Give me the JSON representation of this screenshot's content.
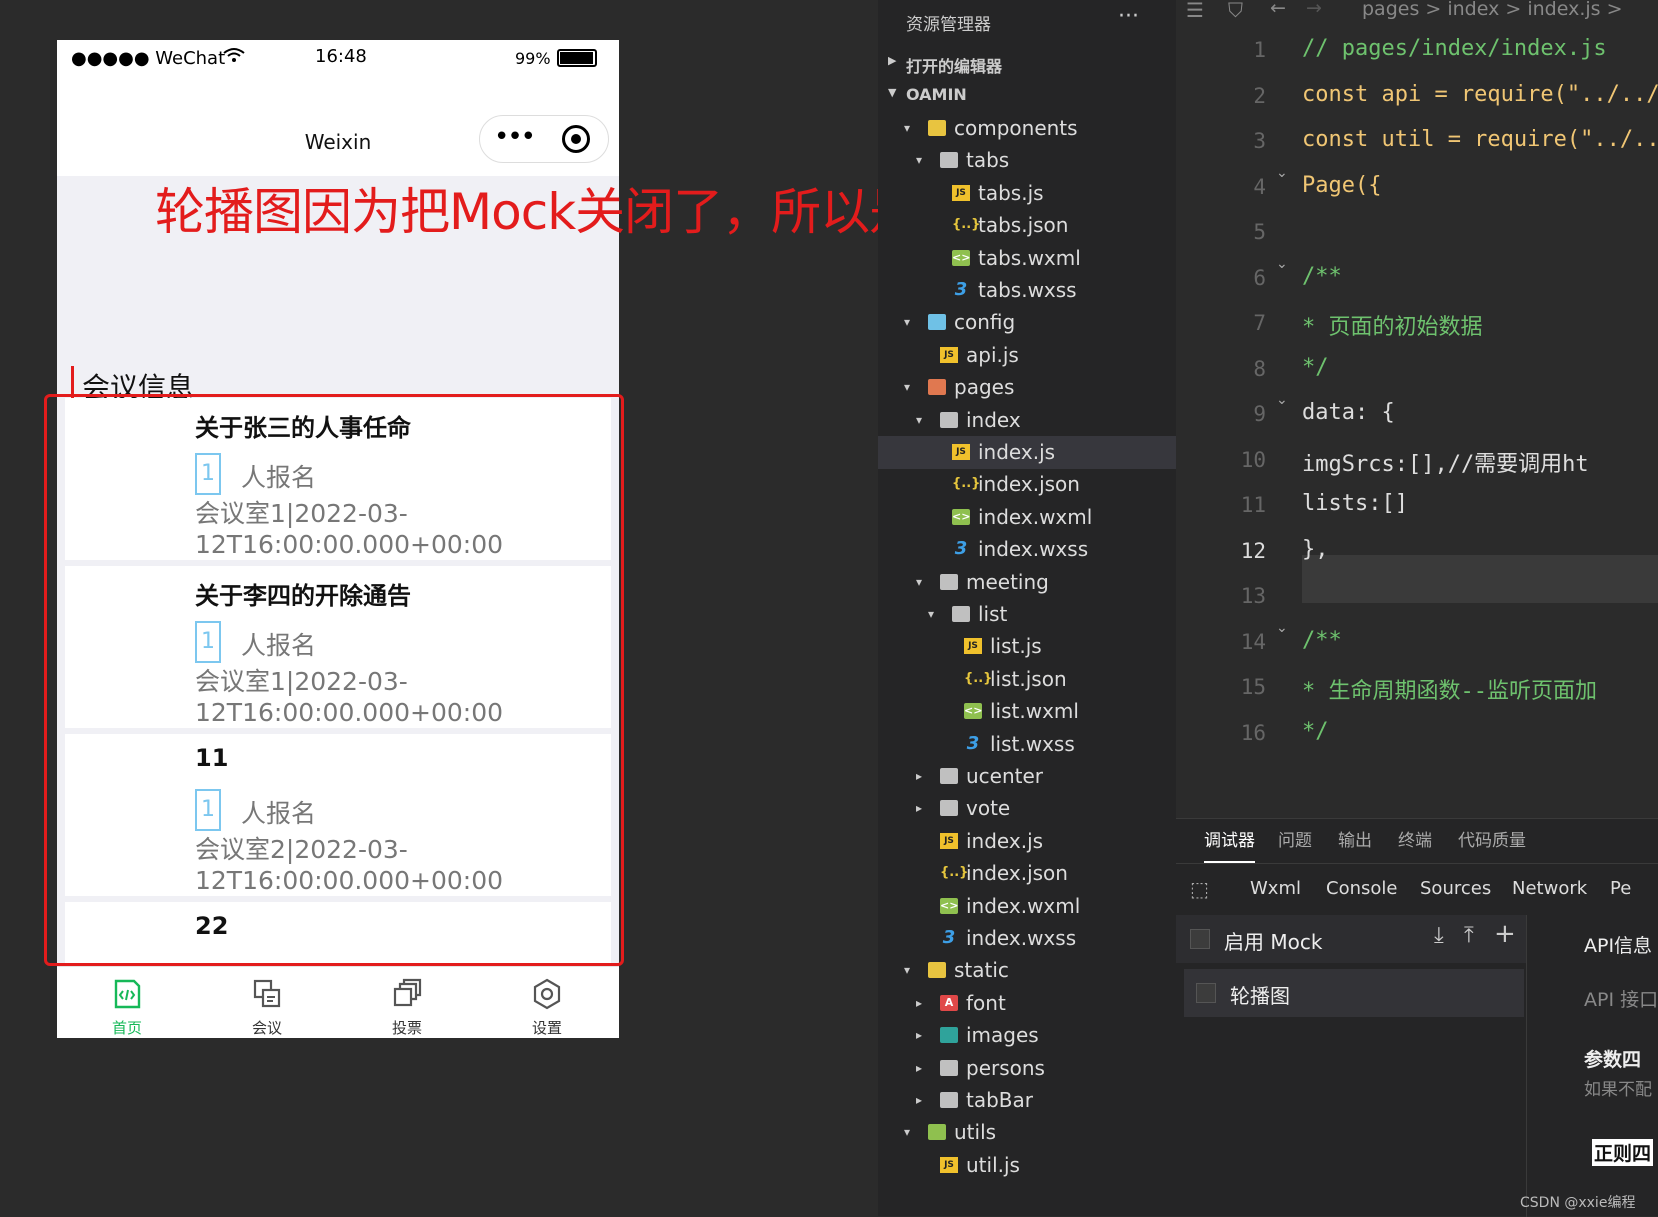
{
  "phone": {
    "status": {
      "carrier": "●●●●● WeChat",
      "time": "16:48",
      "battery": "99%"
    },
    "nav": {
      "title": "Weixin",
      "more": "•••",
      "record": "◉"
    },
    "section_title": "会议信息",
    "annotation": "轮播图因为把Mock关闭了，所以是没有数据的",
    "meetings": [
      {
        "title": "关于张三的人事任命",
        "count": "1",
        "signup": "人报名",
        "location": "会议室1|2022-03-12T16:00:00.000+00:00"
      },
      {
        "title": "关于李四的开除通告",
        "count": "1",
        "signup": "人报名",
        "location": "会议室1|2022-03-12T16:00:00.000+00:00"
      },
      {
        "title": "11",
        "count": "1",
        "signup": "人报名",
        "location": "会议室2|2022-03-12T16:00:00.000+00:00"
      },
      {
        "title": "22",
        "count": "",
        "signup": "",
        "location": ""
      }
    ],
    "tabs": [
      {
        "label": "首页",
        "icon": "home-code-icon",
        "active": true
      },
      {
        "label": "会议",
        "icon": "meeting-icon",
        "active": false
      },
      {
        "label": "投票",
        "icon": "vote-icon",
        "active": false
      },
      {
        "label": "设置",
        "icon": "settings-icon",
        "active": false
      }
    ]
  },
  "explorer": {
    "title": "资源管理器",
    "more": "···",
    "open_editors": "打开的编辑器",
    "project": "OAMIN",
    "tree": [
      {
        "name": "components",
        "icon": "fcomp",
        "arrow": "▾",
        "indent": 0
      },
      {
        "name": "tabs",
        "icon": "folder",
        "arrow": "▾",
        "indent": 1
      },
      {
        "name": "tabs.js",
        "icon": "js",
        "arrow": "",
        "indent": 2
      },
      {
        "name": "tabs.json",
        "icon": "json",
        "arrow": "",
        "indent": 2
      },
      {
        "name": "tabs.wxml",
        "icon": "wxml",
        "arrow": "",
        "indent": 2
      },
      {
        "name": "tabs.wxss",
        "icon": "wxss",
        "arrow": "",
        "indent": 2
      },
      {
        "name": "config",
        "icon": "fcfg",
        "arrow": "▾",
        "indent": 0
      },
      {
        "name": "api.js",
        "icon": "js",
        "arrow": "",
        "indent": 1
      },
      {
        "name": "pages",
        "icon": "fpage",
        "arrow": "▾",
        "indent": 0
      },
      {
        "name": "index",
        "icon": "folder",
        "arrow": "▾",
        "indent": 1
      },
      {
        "name": "index.js",
        "icon": "js",
        "arrow": "",
        "indent": 2,
        "selected": true
      },
      {
        "name": "index.json",
        "icon": "json",
        "arrow": "",
        "indent": 2
      },
      {
        "name": "index.wxml",
        "icon": "wxml",
        "arrow": "",
        "indent": 2
      },
      {
        "name": "index.wxss",
        "icon": "wxss",
        "arrow": "",
        "indent": 2
      },
      {
        "name": "meeting",
        "icon": "folder",
        "arrow": "▾",
        "indent": 1
      },
      {
        "name": "list",
        "icon": "folder",
        "arrow": "▾",
        "indent": 2
      },
      {
        "name": "list.js",
        "icon": "js",
        "arrow": "",
        "indent": 3
      },
      {
        "name": "list.json",
        "icon": "json",
        "arrow": "",
        "indent": 3
      },
      {
        "name": "list.wxml",
        "icon": "wxml",
        "arrow": "",
        "indent": 3
      },
      {
        "name": "list.wxss",
        "icon": "wxss",
        "arrow": "",
        "indent": 3
      },
      {
        "name": "ucenter",
        "icon": "folder",
        "arrow": "▸",
        "indent": 1
      },
      {
        "name": "vote",
        "icon": "folder",
        "arrow": "▸",
        "indent": 1
      },
      {
        "name": "index.js",
        "icon": "js",
        "arrow": "",
        "indent": 1
      },
      {
        "name": "index.json",
        "icon": "json",
        "arrow": "",
        "indent": 1
      },
      {
        "name": "index.wxml",
        "icon": "wxml",
        "arrow": "",
        "indent": 1
      },
      {
        "name": "index.wxss",
        "icon": "wxss",
        "arrow": "",
        "indent": 1
      },
      {
        "name": "static",
        "icon": "fstat",
        "arrow": "▾",
        "indent": 0
      },
      {
        "name": "font",
        "icon": "ffont",
        "arrow": "▸",
        "indent": 1
      },
      {
        "name": "images",
        "icon": "fimg",
        "arrow": "▸",
        "indent": 1
      },
      {
        "name": "persons",
        "icon": "folder",
        "arrow": "▸",
        "indent": 1
      },
      {
        "name": "tabBar",
        "icon": "folder",
        "arrow": "▸",
        "indent": 1
      },
      {
        "name": "utils",
        "icon": "futil",
        "arrow": "▾",
        "indent": 0
      },
      {
        "name": "util.js",
        "icon": "js",
        "arrow": "",
        "indent": 1
      }
    ]
  },
  "editor": {
    "breadcrumb": "pages > index > index.js >",
    "lines": [
      {
        "n": "1",
        "code": "// pages/index/index.js",
        "cls": "c"
      },
      {
        "n": "2",
        "code": "const api = require(\"../../",
        "cls": "k"
      },
      {
        "n": "3",
        "code": "const util = require(\"../..",
        "cls": "k"
      },
      {
        "n": "4",
        "code": "Page({",
        "cls": "k",
        "fold": true
      },
      {
        "n": "5",
        "code": "",
        "cls": "p"
      },
      {
        "n": "6",
        "code": "  /**",
        "cls": "c",
        "fold": true
      },
      {
        "n": "7",
        "code": "   * 页面的初始数据",
        "cls": "c"
      },
      {
        "n": "8",
        "code": "   */",
        "cls": "c"
      },
      {
        "n": "9",
        "code": "  data: {",
        "cls": "p",
        "fold": true
      },
      {
        "n": "10",
        "code": "    imgSrcs:[],//需要调用ht",
        "cls": "p"
      },
      {
        "n": "11",
        "code": "    lists:[]",
        "cls": "p"
      },
      {
        "n": "12",
        "code": "  },",
        "cls": "p"
      },
      {
        "n": "13",
        "code": "",
        "cls": "p"
      },
      {
        "n": "14",
        "code": "  /**",
        "cls": "c",
        "fold": true
      },
      {
        "n": "15",
        "code": "   * 生命周期函数--监听页面加",
        "cls": "c"
      },
      {
        "n": "16",
        "code": "   */",
        "cls": "c"
      }
    ]
  },
  "debugger": {
    "tabs": [
      "调试器",
      "问题",
      "输出",
      "终端",
      "代码质量"
    ],
    "subtabs": [
      "Wxml",
      "Console",
      "Sources",
      "Network",
      "Pe"
    ],
    "mock_label": "启用 Mock",
    "swiper_label": "轮播图",
    "api_info": "API信息",
    "api_port": "API 接口",
    "params": "参数四",
    "params_hint": "如果不配",
    "regex": "正则四"
  },
  "watermark": "CSDN @xxie编程"
}
